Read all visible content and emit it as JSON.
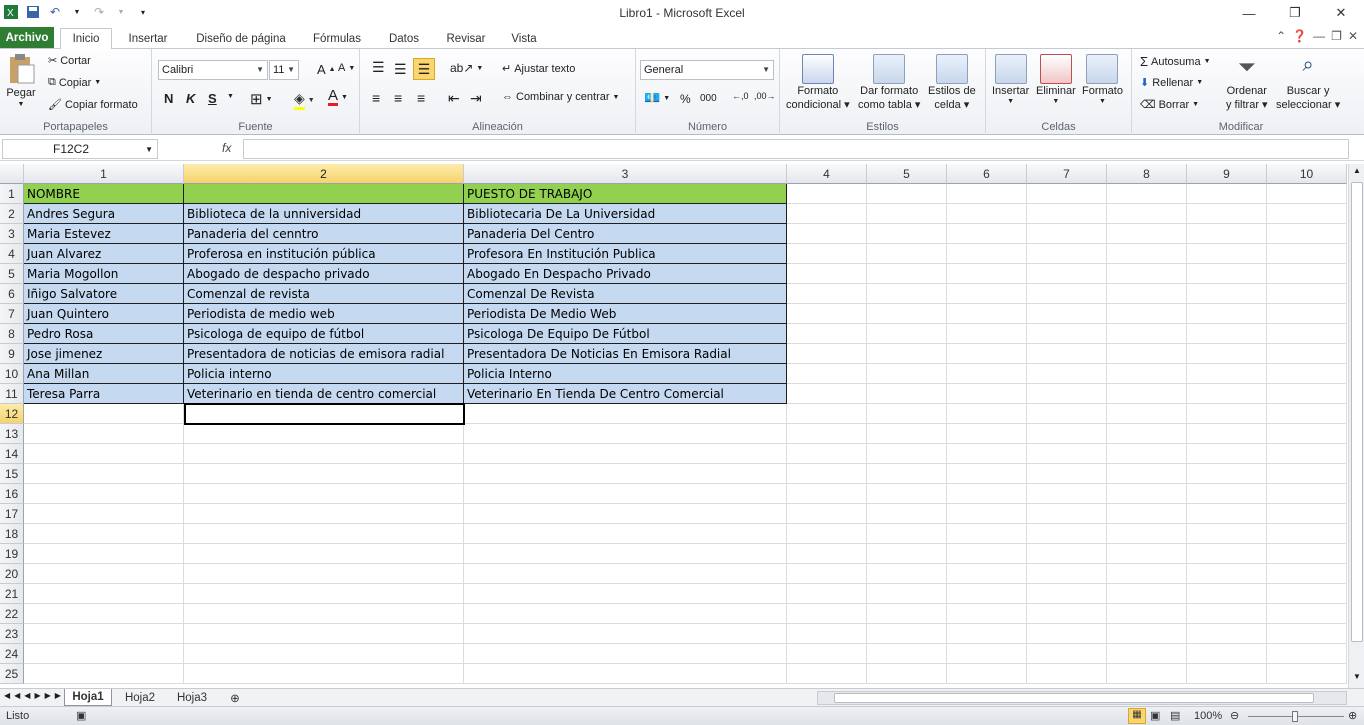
{
  "window": {
    "title": "Libro1  -  Microsoft Excel"
  },
  "tabs": [
    "Archivo",
    "Inicio",
    "Insertar",
    "Diseño de página",
    "Fórmulas",
    "Datos",
    "Revisar",
    "Vista"
  ],
  "ribbon": {
    "portapapeles": {
      "pegar": "Pegar",
      "cortar": "Cortar",
      "copiar": "Copiar",
      "copiar_formato": "Copiar formato",
      "label": "Portapapeles"
    },
    "fuente": {
      "font": "Calibri",
      "size": "11",
      "bold": "N",
      "italic": "K",
      "underline": "S",
      "label": "Fuente"
    },
    "alineacion": {
      "ajustar": "Ajustar texto",
      "combinar": "Combinar y centrar",
      "label": "Alineación"
    },
    "numero": {
      "format": "General",
      "label": "Número"
    },
    "estilos": {
      "formato_condicional": [
        "Formato",
        "condicional"
      ],
      "dar_formato": [
        "Dar formato",
        "como tabla"
      ],
      "estilos_celda": [
        "Estilos de",
        "celda"
      ],
      "label": "Estilos"
    },
    "celdas": {
      "insertar": "Insertar",
      "eliminar": "Eliminar",
      "formato": "Formato",
      "label": "Celdas"
    },
    "modificar": {
      "autosuma": "Autosuma",
      "rellenar": "Rellenar",
      "borrar": "Borrar",
      "ordenar": [
        "Ordenar",
        "y filtrar"
      ],
      "buscar": [
        "Buscar y",
        "seleccionar"
      ],
      "label": "Modificar"
    }
  },
  "formula_bar": {
    "name_box": "F12C2",
    "fx": "fx",
    "value": ""
  },
  "columns": [
    "1",
    "2",
    "3",
    "4",
    "5",
    "6",
    "7",
    "8",
    "9",
    "10"
  ],
  "rows": [
    "1",
    "2",
    "3",
    "4",
    "5",
    "6",
    "7",
    "8",
    "9",
    "10",
    "11",
    "12",
    "13",
    "14",
    "15",
    "16",
    "17",
    "18",
    "19",
    "20",
    "21",
    "22",
    "23",
    "24",
    "25"
  ],
  "data": [
    [
      "NOMBRE",
      "",
      "PUESTO DE TRABAJO"
    ],
    [
      "Andres Segura",
      "Biblioteca de la unniversidad",
      "Bibliotecaria De La Universidad"
    ],
    [
      "Maria Estevez",
      "Panaderia del cenntro",
      "Panaderia Del Centro"
    ],
    [
      "Juan Alvarez",
      "Proferosa en institución pública",
      "Profesora En Institución Publica"
    ],
    [
      "Maria Mogollon",
      "Abogado de despacho privado",
      "Abogado En Despacho Privado"
    ],
    [
      "Iñigo Salvatore",
      "Comenzal de revista",
      "Comenzal De Revista"
    ],
    [
      "Juan Quintero",
      "Periodista de medio web",
      "Periodista De Medio Web"
    ],
    [
      "Pedro Rosa",
      "Psicologa de equipo de fútbol",
      "Psicologa De Equipo De Fútbol"
    ],
    [
      "Jose jimenez",
      "Presentadora de noticias de emisora radial",
      "Presentadora De Noticias En Emisora Radial"
    ],
    [
      "Ana Millan",
      "Policia interno",
      "Policia Interno"
    ],
    [
      "Teresa Parra",
      "Veterinario en tienda de centro comercial",
      "Veterinario En Tienda De Centro Comercial"
    ]
  ],
  "sheets": [
    "Hoja1",
    "Hoja2",
    "Hoja3"
  ],
  "status": {
    "text": "Listo",
    "zoom": "100%"
  },
  "colors": {
    "header_green": "#92d050",
    "data_blue": "#c5d9f1",
    "file_tab": "#2f7d32"
  }
}
